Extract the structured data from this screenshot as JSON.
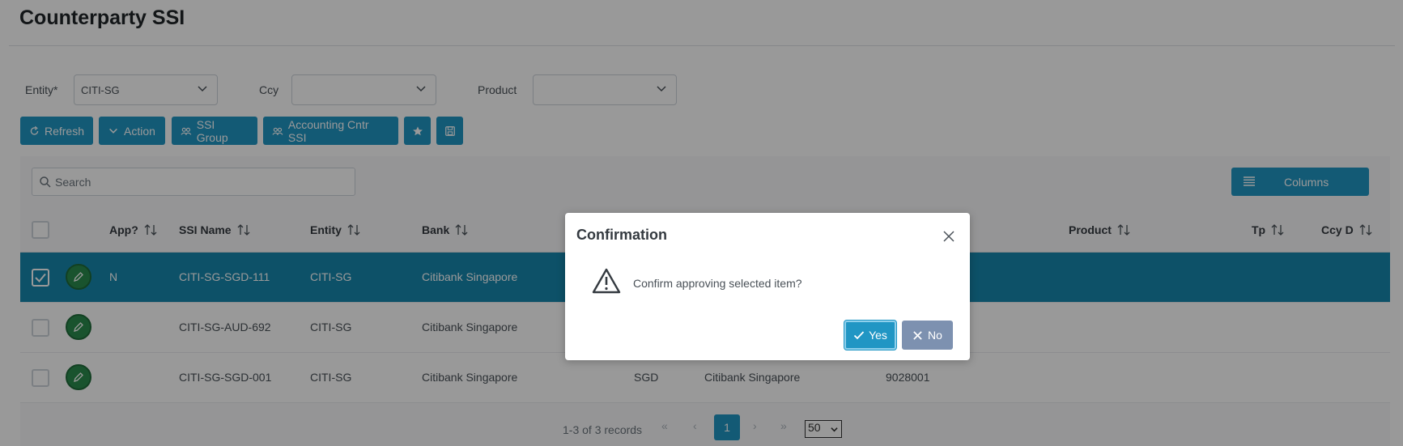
{
  "page": {
    "title": "Counterparty SSI"
  },
  "filters": {
    "entity_label": "Entity*",
    "entity_value": "CITI-SG",
    "ccy_label": "Ccy",
    "ccy_value": "",
    "product_label": "Product",
    "product_value": ""
  },
  "toolbar": {
    "refresh": "Refresh",
    "action": "Action",
    "ssi_group": "SSI Group",
    "accounting": "Accounting Cntr SSI"
  },
  "search": {
    "placeholder": "Search"
  },
  "columns_button": "Columns",
  "table": {
    "headers": {
      "app": "App?",
      "ssi_name": "SSI Name",
      "entity": "Entity",
      "bank": "Bank",
      "product": "Product",
      "tp": "Tp",
      "ccy_d": "Ccy D"
    },
    "rows": [
      {
        "selected": true,
        "app": "N",
        "ssi_name": "CITI-SG-SGD-111",
        "entity": "CITI-SG",
        "bank": "Citibank Singapore",
        "ccy": "",
        "bank2": "",
        "acct": ""
      },
      {
        "selected": false,
        "app": "",
        "ssi_name": "CITI-SG-AUD-692",
        "entity": "CITI-SG",
        "bank": "Citibank Singapore",
        "ccy": "",
        "bank2": "",
        "acct": ""
      },
      {
        "selected": false,
        "app": "",
        "ssi_name": "CITI-SG-SGD-001",
        "entity": "CITI-SG",
        "bank": "Citibank Singapore",
        "ccy": "SGD",
        "bank2": "Citibank Singapore",
        "acct": "9028001"
      }
    ]
  },
  "pager": {
    "summary": "1-3 of 3 records",
    "first": "«",
    "prev": "‹",
    "current": "1",
    "next": "›",
    "last": "»",
    "page_size": "50"
  },
  "dialog": {
    "title": "Confirmation",
    "message": "Confirm approving selected item?",
    "yes": "Yes",
    "no": "No"
  },
  "colors": {
    "primary": "#2196c4",
    "selected_row": "#1787ae",
    "edit_button": "#2a8b4e",
    "no_button": "#7d91b0"
  }
}
